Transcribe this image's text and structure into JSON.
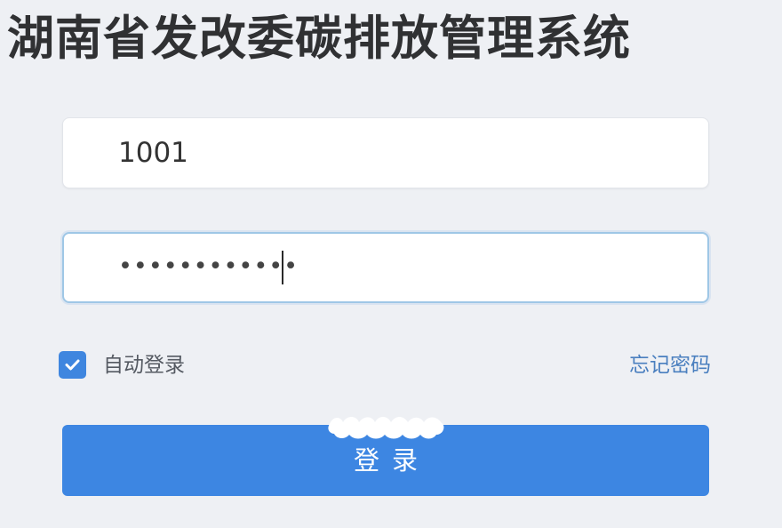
{
  "app": {
    "title": "湖南省发改委碳排放管理系统"
  },
  "login_form": {
    "username_value": "1001",
    "password_value": "••••••••••••",
    "remember_label": "自动登录",
    "remember_checked": true,
    "forgot_label": "忘记密码",
    "login_label": "登录"
  },
  "icons": {
    "checkbox": "check-icon"
  },
  "colors": {
    "accent": "#3d86e2",
    "background": "#eef0f4",
    "link": "#4a7fbf"
  }
}
